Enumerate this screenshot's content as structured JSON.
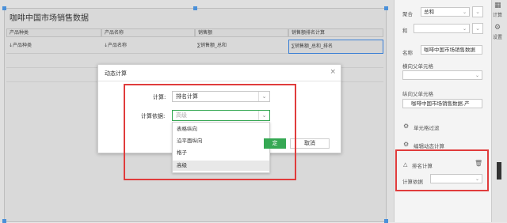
{
  "sheet": {
    "title": "咖啡中国市场销售数据",
    "headers": [
      "产品种类",
      "产品名称",
      "销售额",
      "销售额排名计算"
    ],
    "row": [
      "↓产品种类",
      "↓产品名称",
      "∑销售额_总和",
      "∑销售额_总和_排名"
    ]
  },
  "dialog": {
    "title": "动态计算",
    "calc_label": "计算:",
    "calc_value": "排名计算",
    "basis_label": "计算依据:",
    "basis_placeholder": "高级",
    "options": [
      "表格纵向",
      "沿平面纵向",
      "格子",
      "高级"
    ],
    "highlighted_option": "高级",
    "ok_label": "定",
    "cancel_label": "取消"
  },
  "panel": {
    "aggregate_label": "聚合",
    "aggregate_value": "总和",
    "and_label": "和",
    "name_label": "名称",
    "name_value": "咖啡中国市场销售数据",
    "horizontal_parent_label": "横向父单元格",
    "vertical_parent_label": "纵向父单元格",
    "vertical_parent_value": "咖啡中国市场销售数据.产",
    "cell_filter_label": "单元格过滤",
    "edit_dynamic_label": "编辑动态计算",
    "rank_calc_label": "排名计算",
    "calc_basis_label": "计算依据"
  },
  "sidebar": {
    "calc_label": "计算",
    "settings_label": "设置"
  },
  "colors": {
    "accent": "#35a853",
    "highlight": "#e03c3c",
    "selection": "#3a7fd5"
  }
}
